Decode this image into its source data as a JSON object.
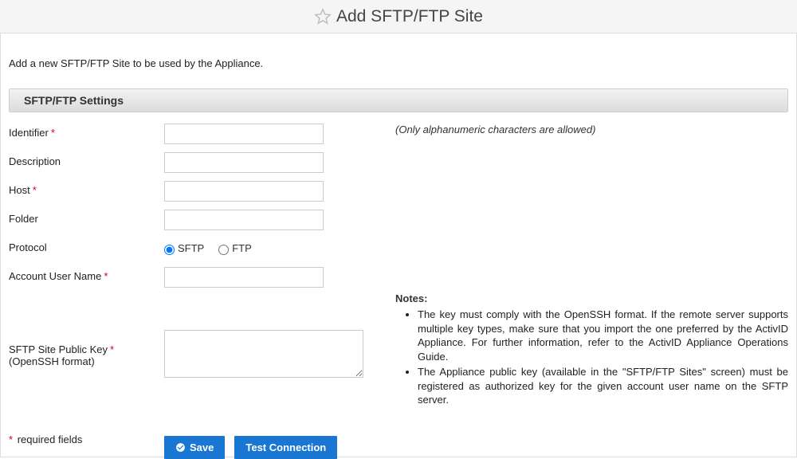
{
  "header": {
    "title": "Add SFTP/FTP Site"
  },
  "intro": "Add a new SFTP/FTP Site to be used by the Appliance.",
  "section": {
    "title": "SFTP/FTP Settings"
  },
  "form": {
    "identifier": {
      "label": "Identifier",
      "value": "",
      "hint": "(Only alphanumeric characters are allowed)",
      "required": true
    },
    "description": {
      "label": "Description",
      "value": "",
      "required": false
    },
    "host": {
      "label": "Host",
      "value": "",
      "required": true
    },
    "folder": {
      "label": "Folder",
      "value": "",
      "required": false
    },
    "protocol": {
      "label": "Protocol",
      "options": [
        "SFTP",
        "FTP"
      ],
      "selected": "SFTP"
    },
    "account": {
      "label": "Account User Name",
      "value": "",
      "required": true
    },
    "publickey": {
      "label_line1": "SFTP Site Public Key",
      "label_line2": "(OpenSSH format)",
      "value": "",
      "required": true
    }
  },
  "notes": {
    "title": "Notes:",
    "items": [
      "The key must comply with the OpenSSH format. If the remote server supports multiple key types, make sure that you import the one preferred by the ActivID Appliance. For further information, refer to the ActivID Appliance Operations Guide.",
      "The Appliance public key (available in the \"SFTP/FTP Sites\" screen) must be registered as authorized key for the given account user name on the SFTP server."
    ]
  },
  "buttons": {
    "save": "Save",
    "test": "Test Connection"
  },
  "footer": {
    "required": "required fields"
  },
  "asterisk": "*"
}
